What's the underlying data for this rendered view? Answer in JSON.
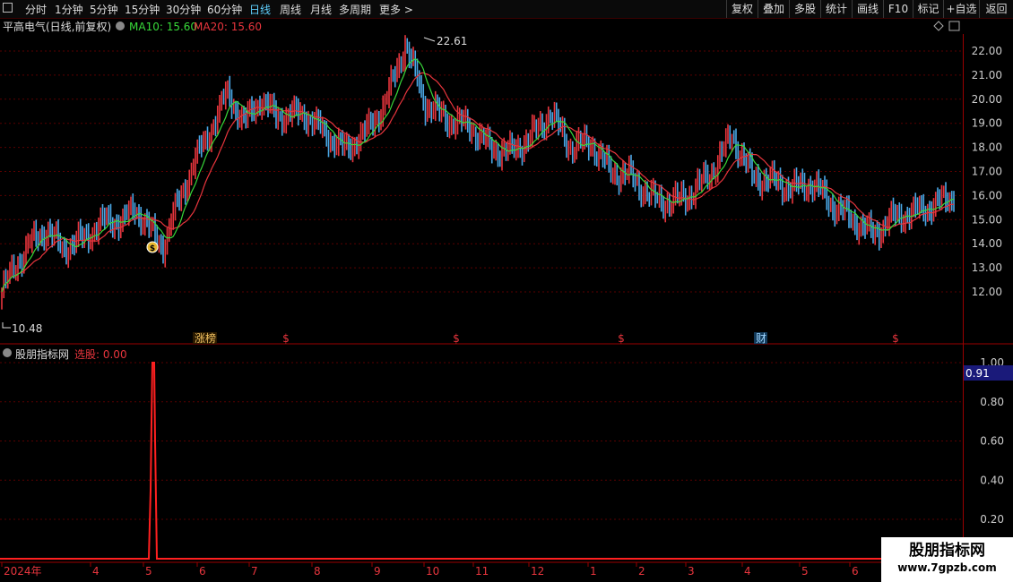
{
  "toolbar": {
    "left": [
      "分时",
      "1分钟",
      "5分钟",
      "15分钟",
      "30分钟",
      "60分钟",
      "日线",
      "周线",
      "月线",
      "多周期",
      "更多 >"
    ],
    "right": [
      "复权",
      "叠加",
      "多股",
      "统计",
      "画线",
      "F10",
      "标记",
      "+自选",
      "返回"
    ]
  },
  "info": {
    "title": "平高电气(日线,前复权)",
    "ma10": "MA10: 15.60",
    "ma20": "MA20: 15.60"
  },
  "indicator": {
    "name": "股朋指标网",
    "label": "选股: 0.00",
    "current_value": "0.91"
  },
  "price_axis": {
    "labels": [
      "22.00",
      "21.00",
      "20.00",
      "19.00",
      "18.00",
      "17.00",
      "16.00",
      "15.00",
      "14.00",
      "13.00",
      "12.00"
    ],
    "high_mark": "22.61",
    "low_mark": "10.48"
  },
  "indicator_axis": {
    "labels": [
      "1.00",
      "0.80",
      "0.60",
      "0.40",
      "0.20"
    ]
  },
  "time_axis": {
    "labels": [
      "2024年",
      "4",
      "5",
      "6",
      "7",
      "8",
      "9",
      "10",
      "11",
      "12",
      "1",
      "2",
      "3",
      "4",
      "5",
      "6"
    ]
  },
  "event_markers": [
    "涨榜",
    "$",
    "$",
    "$",
    "财",
    "$"
  ],
  "watermark": {
    "line1": "股朋指标网",
    "line2": "www.7gpzb.com"
  },
  "colors": {
    "up": "#e8353d",
    "down": "#4aa8e6",
    "ma10": "#38d93a",
    "ma20": "#e8353d",
    "grid": "#5a0000",
    "active_period": "#5fd0ff"
  },
  "chart_data": {
    "type": "candlestick",
    "x_range": [
      "2024-03",
      "2025-06"
    ],
    "y_range": [
      10.48,
      22.61
    ],
    "series": [
      {
        "name": "MA10",
        "values": [
          15.6
        ]
      },
      {
        "name": "MA20",
        "values": [
          15.6
        ]
      }
    ]
  }
}
